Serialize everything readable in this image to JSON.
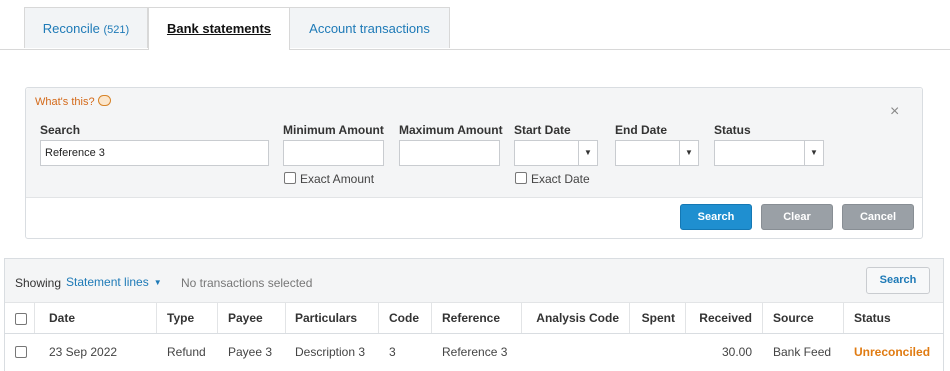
{
  "tabs": [
    {
      "label": "Reconcile",
      "count": "(521)"
    },
    {
      "label": "Bank statements"
    },
    {
      "label": "Account transactions"
    }
  ],
  "search_panel": {
    "whats_this": "What's this?",
    "close_icon": "×",
    "fields": {
      "search": {
        "label": "Search",
        "value": "Reference 3"
      },
      "min_amount": {
        "label": "Minimum Amount",
        "value": ""
      },
      "max_amount": {
        "label": "Maximum Amount",
        "value": ""
      },
      "start_date": {
        "label": "Start Date",
        "value": ""
      },
      "end_date": {
        "label": "End Date",
        "value": ""
      },
      "status": {
        "label": "Status",
        "value": ""
      }
    },
    "exact_amount_label": "Exact Amount",
    "exact_date_label": "Exact Date",
    "buttons": {
      "search": "Search",
      "clear": "Clear",
      "cancel": "Cancel"
    }
  },
  "lines": {
    "showing_label": "Showing",
    "view_label": "Statement lines",
    "selection_status": "No transactions selected",
    "search_button": "Search",
    "columns": [
      "Date",
      "Type",
      "Payee",
      "Particulars",
      "Code",
      "Reference",
      "Analysis Code",
      "Spent",
      "Received",
      "Source",
      "Status"
    ],
    "rows": [
      {
        "date": "23 Sep 2022",
        "type": "Refund",
        "payee": "Payee 3",
        "particulars": "Description 3",
        "code": "3",
        "reference": "Reference 3",
        "analysis_code": "",
        "spent": "",
        "received": "30.00",
        "source": "Bank Feed",
        "status": "Unreconciled"
      }
    ]
  },
  "colors": {
    "link": "#1e7ab7",
    "primary_button": "#1f8fd0",
    "status_unreconciled": "#e07b12",
    "whats_this": "#d46a1a"
  },
  "icons": {
    "whats_this": "speech-bubble-icon",
    "close": "close-icon",
    "dropdown": "caret-down-icon"
  }
}
